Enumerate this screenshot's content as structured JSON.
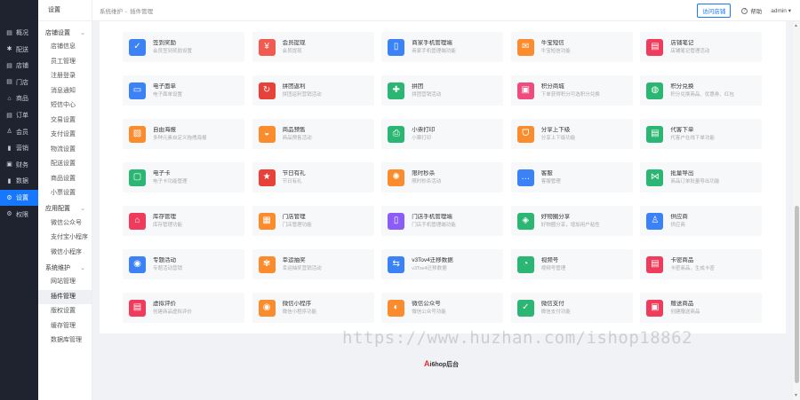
{
  "rail": [
    {
      "icon": "overview-icon",
      "glyph": "▤",
      "label": "概况"
    },
    {
      "icon": "config-icon",
      "glyph": "✱",
      "label": "配送"
    },
    {
      "icon": "store-icon",
      "glyph": "▤",
      "label": "店铺"
    },
    {
      "icon": "shop-door-icon",
      "glyph": "▤",
      "label": "门店"
    },
    {
      "icon": "goods-icon",
      "glyph": "⌂",
      "label": "商品"
    },
    {
      "icon": "order-icon",
      "glyph": "▤",
      "label": "订单"
    },
    {
      "icon": "member-icon",
      "glyph": "♙",
      "label": "会员"
    },
    {
      "icon": "marketing-icon",
      "glyph": "▮",
      "label": "营销"
    },
    {
      "icon": "finance-icon",
      "glyph": "▣",
      "label": "财务"
    },
    {
      "icon": "data-icon",
      "glyph": "▮",
      "label": "数据"
    },
    {
      "icon": "settings-icon",
      "glyph": "⚙",
      "label": "设置",
      "active": true
    },
    {
      "icon": "upgrade-icon",
      "glyph": "⚙",
      "label": "权限"
    }
  ],
  "subnav": {
    "head": "设置",
    "groups": [
      {
        "label": "店铺设置",
        "items": [
          "店铺信息",
          "员工管理",
          "注册登录",
          "消息通知",
          "短信中心",
          "交易设置",
          "支付设置",
          "物流设置",
          "配送设置",
          "商品设置",
          "小票设置"
        ]
      },
      {
        "label": "应用配置",
        "items": [
          "微信公众号",
          "支付宝小程序",
          "微信小程序"
        ]
      },
      {
        "label": "系统维护",
        "items": [
          "网站管理",
          "插件管理",
          "版权设置",
          "缓存管理",
          "数据库管理"
        ],
        "active": "插件管理"
      }
    ]
  },
  "topbar": {
    "crumb_parent": "系统维护",
    "crumb_sep": "-",
    "crumb_current": "插件管理",
    "visit_label": "访问店铺",
    "help_label": "帮助",
    "user_label": "admin ▾"
  },
  "plugins": [
    {
      "title": "签到奖励",
      "desc": "会员签到奖励设置",
      "color": "#3b82f6",
      "icon": "calendar-check-icon",
      "glyph": "✓"
    },
    {
      "title": "会员提现",
      "desc": "会员提现",
      "color": "#f05a4f",
      "icon": "withdraw-icon",
      "glyph": "¥"
    },
    {
      "title": "商家手机管理端",
      "desc": "商家手机管理端功能",
      "color": "#3b82f6",
      "icon": "mobile-admin-icon",
      "glyph": "▯"
    },
    {
      "title": "牛宝短信",
      "desc": "牛宝短信功能",
      "color": "#fb8c2e",
      "icon": "sms-icon",
      "glyph": "✉"
    },
    {
      "title": "店铺笔记",
      "desc": "店铺笔记管理活动",
      "color": "#ef3b5c",
      "icon": "note-icon",
      "glyph": "▤"
    },
    {
      "title": "电子面单",
      "desc": "电子面单设置",
      "color": "#3b82f6",
      "icon": "waybill-icon",
      "glyph": "▭"
    },
    {
      "title": "拼团返利",
      "desc": "拼团返利营销活动",
      "color": "#e8413a",
      "icon": "group-rebate-icon",
      "glyph": "↻"
    },
    {
      "title": "拼团",
      "desc": "拼团营销活动",
      "color": "#2bb673",
      "icon": "puzzle-icon",
      "glyph": "✚"
    },
    {
      "title": "积分商城",
      "desc": "下单获得积分可选积分兑换",
      "color": "#ef4b7e",
      "icon": "points-mall-icon",
      "glyph": "▣"
    },
    {
      "title": "积分兑换",
      "desc": "积分兑换商品、优惠券、红包",
      "color": "#2bb673",
      "icon": "points-exchange-icon",
      "glyph": "◍"
    },
    {
      "title": "自由海报",
      "desc": "多种元素自定义拖拽海报",
      "color": "#fb8c2e",
      "icon": "poster-icon",
      "glyph": "▨"
    },
    {
      "title": "商品预售",
      "desc": "商品预售活动",
      "color": "#fb8c2e",
      "icon": "presale-icon",
      "glyph": "◒"
    },
    {
      "title": "小票打印",
      "desc": "小票打印",
      "color": "#2bb673",
      "icon": "printer-icon",
      "glyph": "⎙"
    },
    {
      "title": "分享上下级",
      "desc": "分享上下级功能",
      "color": "#fb8c2e",
      "icon": "share-tier-icon",
      "glyph": "ᗜ"
    },
    {
      "title": "代客下单",
      "desc": "代客户在线下单功能",
      "color": "#2bb673",
      "icon": "proxy-order-icon",
      "glyph": "▤"
    },
    {
      "title": "电子卡",
      "desc": "电子卡功能管理",
      "color": "#2bb673",
      "icon": "ecard-icon",
      "glyph": "▢"
    },
    {
      "title": "节日有礼",
      "desc": "节日有礼",
      "color": "#e8413a",
      "icon": "star-gift-icon",
      "glyph": "★"
    },
    {
      "title": "限时秒杀",
      "desc": "限时秒杀活动",
      "color": "#fb8c2e",
      "icon": "flash-sale-icon",
      "glyph": "✺"
    },
    {
      "title": "客服",
      "desc": "客服管理",
      "color": "#3b82f6",
      "icon": "chat-service-icon",
      "glyph": "…"
    },
    {
      "title": "批量导出",
      "desc": "商品订单批量导出功能",
      "color": "#2bb673",
      "icon": "batch-export-icon",
      "glyph": "⋈"
    },
    {
      "title": "库存管理",
      "desc": "库存管理功能",
      "color": "#ef3b5c",
      "icon": "warehouse-icon",
      "glyph": "⌂"
    },
    {
      "title": "门店管理",
      "desc": "门店管理功能",
      "color": "#fb8c2e",
      "icon": "store-manage-icon",
      "glyph": "▦"
    },
    {
      "title": "门店手机管理端",
      "desc": "门店手机管理端功能",
      "color": "#8b5cf6",
      "icon": "store-mobile-icon",
      "glyph": "▯"
    },
    {
      "title": "好物圈分享",
      "desc": "好物圈分享，增加用户粘性",
      "color": "#2bb673",
      "icon": "good-share-icon",
      "glyph": "◈"
    },
    {
      "title": "供应商",
      "desc": "供应商",
      "color": "#3b82f6",
      "icon": "supplier-icon",
      "glyph": "♙"
    },
    {
      "title": "专题活动",
      "desc": "专题活动营销",
      "color": "#3b82f6",
      "icon": "topic-icon",
      "glyph": "◉"
    },
    {
      "title": "幸运抽奖",
      "desc": "幸运抽奖营销活动",
      "color": "#fb8c2e",
      "icon": "lucky-draw-icon",
      "glyph": "✾"
    },
    {
      "title": "v3Tov4迁移数据",
      "desc": "v3Tov4迁移数据",
      "color": "#3b82f6",
      "icon": "migrate-icon",
      "glyph": "⇆"
    },
    {
      "title": "视频号",
      "desc": "视频号管理",
      "color": "#2bb673",
      "icon": "video-channel-icon",
      "glyph": "◔"
    },
    {
      "title": "卡密商品",
      "desc": "卡密商品，生成卡密",
      "color": "#ef3b5c",
      "icon": "card-goods-icon",
      "glyph": "▤"
    },
    {
      "title": "虚拟评价",
      "desc": "创建商品虚拟评价",
      "color": "#ef3b5c",
      "icon": "review-icon",
      "glyph": "▤"
    },
    {
      "title": "微信小程序",
      "desc": "微信小程序功能",
      "color": "#fb8c2e",
      "icon": "wechat-mini-icon",
      "glyph": "◉"
    },
    {
      "title": "微信公众号",
      "desc": "微信公众号功能",
      "color": "#fb8c2e",
      "icon": "wechat-oa-icon",
      "glyph": "◐"
    },
    {
      "title": "微信支付",
      "desc": "微信支付功能",
      "color": "#2bb673",
      "icon": "wechat-pay-icon",
      "glyph": "✓"
    },
    {
      "title": "赠送商品",
      "desc": "创建赠送商品",
      "color": "#ef3b5c",
      "icon": "gift-goods-icon",
      "glyph": "▣"
    }
  ],
  "watermark": "https://www.huzhan.com/ishop18862",
  "footer_brand": {
    "a": "A",
    "rest": "i6hop后台"
  }
}
